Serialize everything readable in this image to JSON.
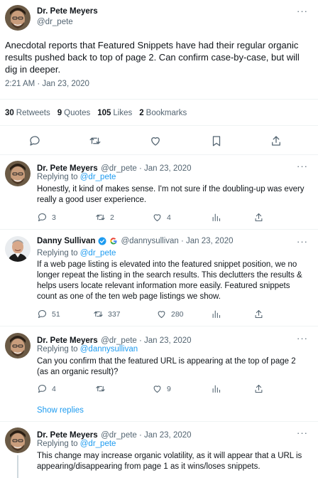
{
  "main_tweet": {
    "author_name": "Dr. Pete Meyers",
    "author_handle": "@dr_pete",
    "text": "Anecdotal reports that Featured Snippets have had their regular organic results pushed back to top of page 2. Can confirm case-by-case, but will dig in deeper.",
    "timestamp": "2:21 AM · Jan 23, 2020",
    "stats": {
      "retweets_count": "30",
      "retweets_label": "Retweets",
      "quotes_count": "9",
      "quotes_label": "Quotes",
      "likes_count": "105",
      "likes_label": "Likes",
      "bookmarks_count": "2",
      "bookmarks_label": "Bookmarks"
    },
    "more": "···"
  },
  "replies": [
    {
      "author_name": "Dr. Pete Meyers",
      "handle_date": "@dr_pete · Jan 23, 2020",
      "replying_to_label": "Replying to",
      "replying_to": "@dr_pete",
      "text": "Honestly, it kind of makes sense. I'm not sure if the doubling-up was every really a good user experience.",
      "reply_count": "3",
      "retweet_count": "2",
      "like_count": "4",
      "more": "···"
    },
    {
      "author_name": "Danny Sullivan",
      "handle_date": "@dannysullivan · Jan 23, 2020",
      "replying_to_label": "Replying to",
      "replying_to": "@dr_pete",
      "text": "If a web page listing is elevated into the featured snippet position, we no longer repeat the listing in the search results. This declutters the results & helps users locate relevant information more easily. Featured snippets count as one of the ten web page listings we show.",
      "reply_count": "51",
      "retweet_count": "337",
      "like_count": "280",
      "more": "···"
    },
    {
      "author_name": "Dr. Pete Meyers",
      "handle_date": "@dr_pete · Jan 23, 2020",
      "replying_to_label": "Replying to",
      "replying_to": "@dannysullivan",
      "text": "Can you confirm that the featured URL is appearing at the top of page 2 (as an organic result)?",
      "reply_count": "4",
      "retweet_count": "",
      "like_count": "9",
      "more": "···"
    },
    {
      "author_name": "Dr. Pete Meyers",
      "handle_date": "@dr_pete · Jan 23, 2020",
      "replying_to_label": "Replying to",
      "replying_to": "@dr_pete",
      "text": "This change may increase organic volatility, as it will appear that a URL is appearing/disappearing from page 1 as it wins/loses snippets.",
      "more": "···"
    }
  ],
  "show_replies": "Show replies",
  "colors": {
    "accent": "#1d9bf0",
    "muted": "#536471",
    "divider": "#eff3f4"
  }
}
